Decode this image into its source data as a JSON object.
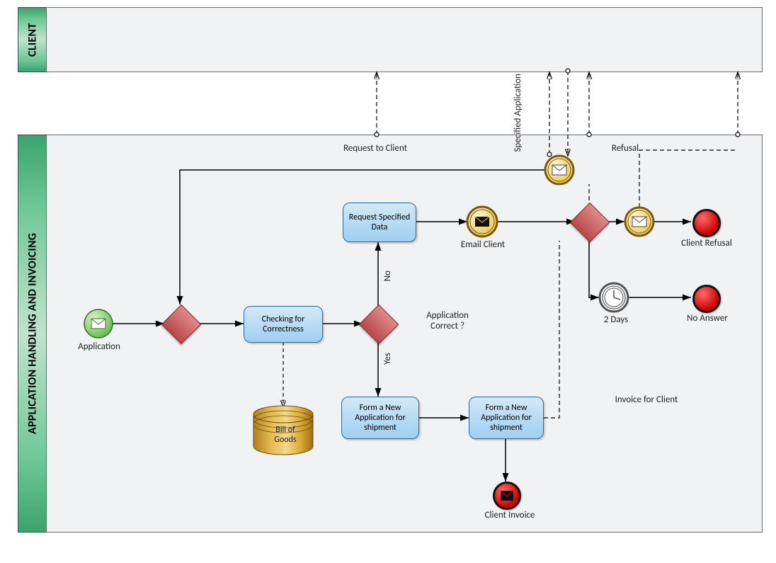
{
  "pools": {
    "client": {
      "label": "CLIENT"
    },
    "app": {
      "label": "APPLICATION HANDLING AND INVOICING"
    }
  },
  "events": {
    "start": {
      "label": "Application"
    },
    "emailClient": {
      "label": "Email Client"
    },
    "clientInvoice": {
      "label": "Client Invoice"
    },
    "clientRefusal": {
      "label": "Client Refusal"
    },
    "noAnswer": {
      "label": "No Answer"
    },
    "twoDays": {
      "label": "2 Days"
    }
  },
  "tasks": {
    "check": {
      "label": "Checking for Correctness"
    },
    "request": {
      "label": "Request Specified Data"
    },
    "form1": {
      "label": "Form a New Application for shipment"
    },
    "form2": {
      "label": "Form a New Application for shipment"
    }
  },
  "data": {
    "datastore": {
      "label": "Bill of Goods"
    }
  },
  "labels": {
    "requestToClient": "Request to Client",
    "specifiedApp": "Specified Application",
    "refusal": "Refusal",
    "invoiceForClient": "Invoice for Client",
    "appCorrect": "Application Correct ?",
    "yes": "Yes",
    "no": "No"
  }
}
